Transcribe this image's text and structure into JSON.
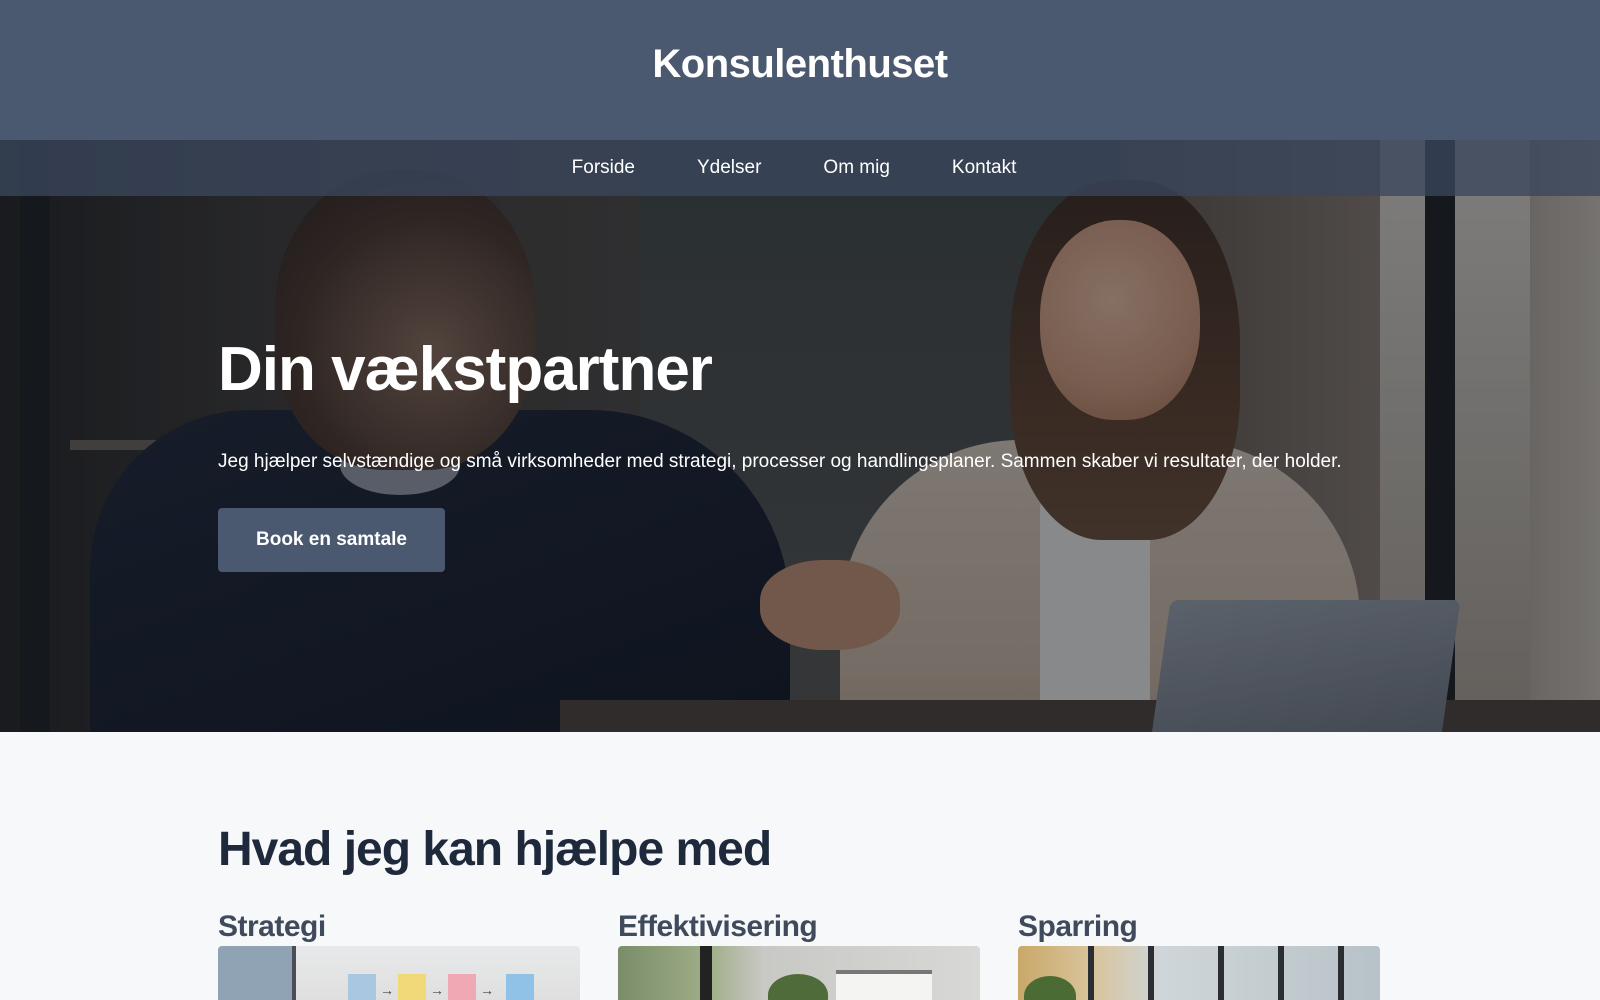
{
  "brand": {
    "name": "Konsulenthuset"
  },
  "nav": {
    "items": [
      {
        "label": "Forside"
      },
      {
        "label": "Ydelser"
      },
      {
        "label": "Om mig"
      },
      {
        "label": "Kontakt"
      }
    ]
  },
  "hero": {
    "title": "Din vækstpartner",
    "text": "Jeg hjælper selvstændige og små virksomheder med strategi, processer og handlingsplaner. Sammen skaber vi resultater, der holder.",
    "cta_label": "Book en samtale",
    "image": "handshake-meeting-photo"
  },
  "services": {
    "title": "Hvad jeg kan hjælpe med",
    "cards": [
      {
        "title": "Strategi",
        "image": "sticky-notes-process-photo"
      },
      {
        "title": "Effektivisering",
        "image": "desk-plant-calendar-photo"
      },
      {
        "title": "Sparring",
        "image": "office-glass-wall-photo"
      }
    ]
  },
  "colors": {
    "header_bg": "#4a5870",
    "cta_bg": "#4a5870",
    "heading": "#1e293b",
    "page_bg": "#f7f8fa"
  }
}
